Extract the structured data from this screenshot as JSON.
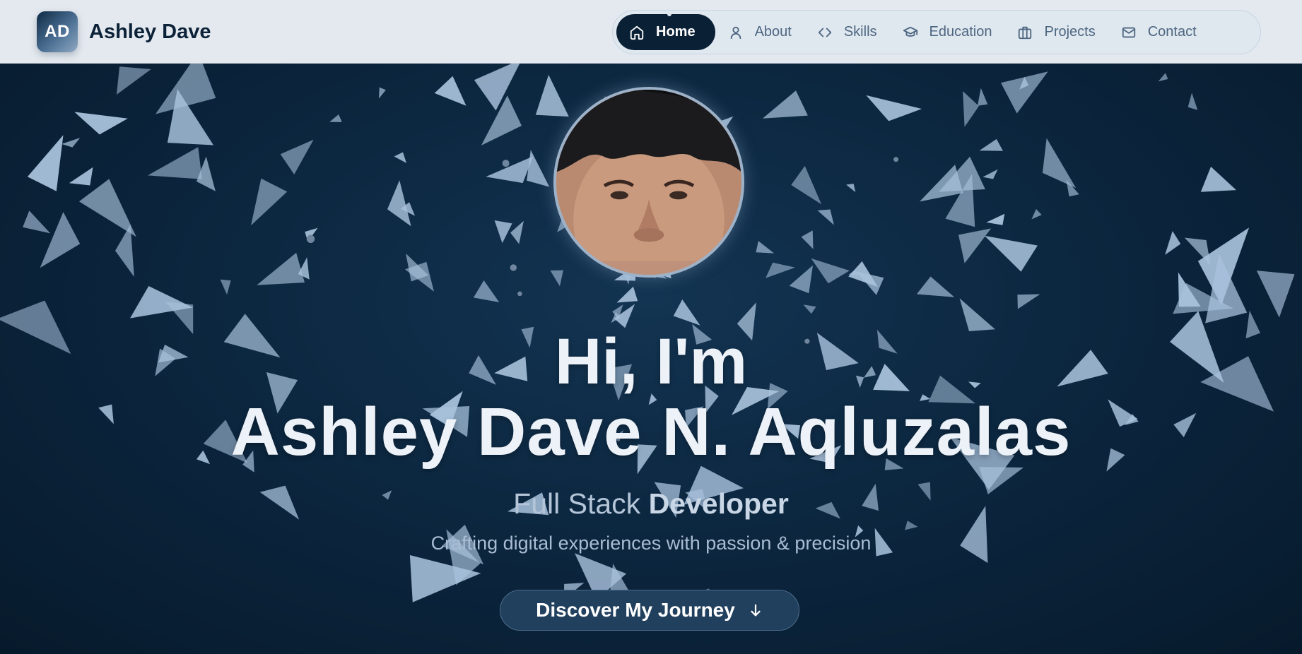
{
  "header": {
    "logo_text": "AD",
    "brand_name": "Ashley Dave"
  },
  "nav": {
    "items": [
      {
        "label": "Home",
        "icon": "home-icon",
        "active": true
      },
      {
        "label": "About",
        "icon": "user-icon",
        "active": false
      },
      {
        "label": "Skills",
        "icon": "code-icon",
        "active": false
      },
      {
        "label": "Education",
        "icon": "graduation-cap-icon",
        "active": false
      },
      {
        "label": "Projects",
        "icon": "briefcase-icon",
        "active": false
      },
      {
        "label": "Contact",
        "icon": "mail-icon",
        "active": false
      }
    ]
  },
  "hero": {
    "greeting": "Hi, I'm",
    "name": "Ashley Dave N. Aqluzalas",
    "role_light": "Full Stack",
    "role_bold": "Developer",
    "tagline": "Crafting digital experiences with passion & precision",
    "cta_label": "Discover My Journey",
    "cta_icon": "arrow-down-icon",
    "avatar": "profile-photo"
  },
  "colors": {
    "header_bg": "#e4e9ef",
    "active_nav_bg": "#0a2035",
    "hero_bg": "#0c2740",
    "hero_text": "#edf2f8",
    "cta_bg": "#21405e",
    "shard_color": "#a9c2dc"
  }
}
